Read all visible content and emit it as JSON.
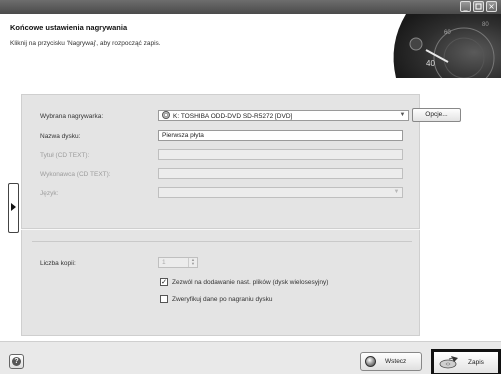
{
  "window": {
    "minimize_glyph": "_",
    "close_glyph": "×"
  },
  "header": {
    "title": "Końcowe ustawienia nagrywania",
    "subtitle": "Kliknij na przycisku 'Nagrywaj', aby rozpocząć zapis."
  },
  "form": {
    "recorder_label": "Wybrana nagrywarka:",
    "recorder_value": "K: TOSHIBA ODD-DVD SD-R5272  [DVD]",
    "options_button": "Opcje...",
    "disc_name_label": "Nazwa dysku:",
    "disc_name_value": "Pierwsza płyta",
    "cd_text_title_label": "Tytuł (CD TEXT):",
    "cd_text_artist_label": "Wykonawca (CD TEXT):",
    "language_label": "Język:",
    "copies_label": "Liczba kopii:",
    "copies_value": "1",
    "allow_append_label": "Zezwól na dodawanie nast. plików (dysk wielosesyjny)",
    "allow_append_checked": "✓",
    "verify_label": "Zweryfikuj dane po nagraniu dysku",
    "verify_checked": ""
  },
  "footer": {
    "help_glyph": "?",
    "back_button": "Wstecz",
    "burn_button": "Zapis"
  },
  "colors": {
    "titlebar": "#5a5a5a",
    "panel": "#e4e4e4",
    "footer": "#e9e9e9"
  }
}
